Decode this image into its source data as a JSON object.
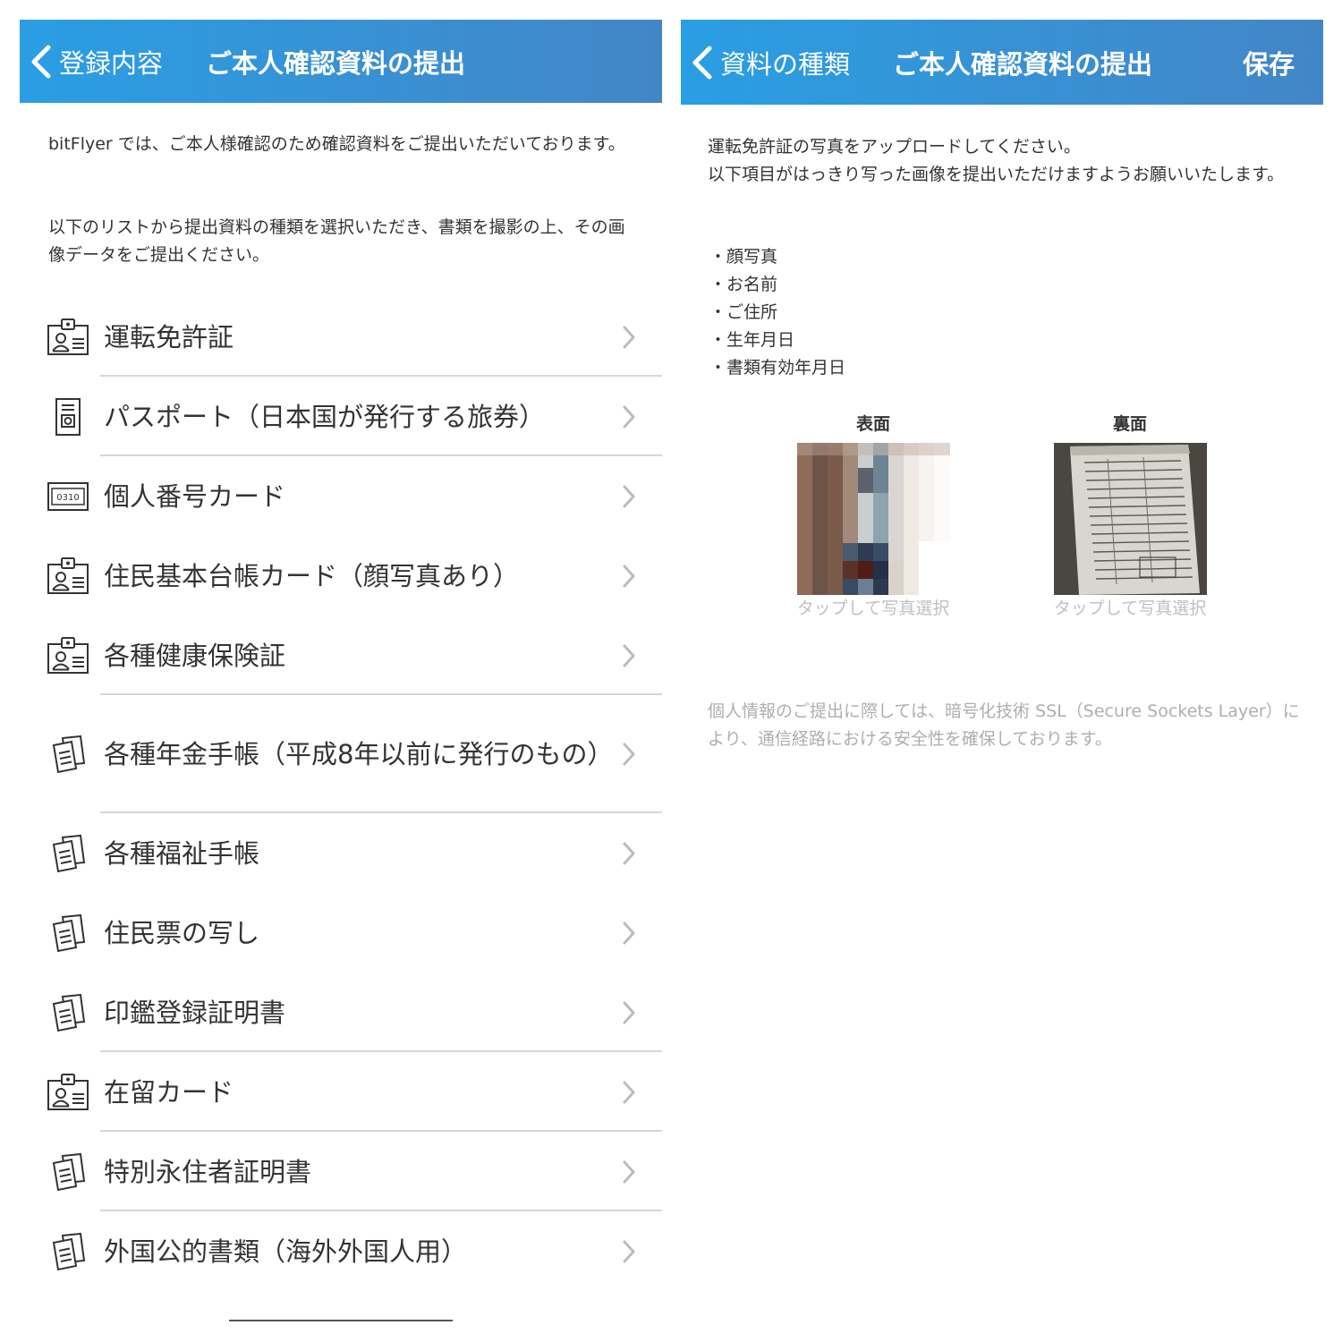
{
  "left_screen": {
    "nav": {
      "back_label": "登録内容",
      "title": "ご本人確認資料の提出"
    },
    "intro": [
      "bitFlyer では、ご本人様確認のため確認資料をご提出いただいております。",
      "以下のリストから提出資料の種類を選択いただき、書類を撮影の上、その画像データをご提出ください。"
    ],
    "documents": [
      {
        "label": "運転免許証",
        "icon": "id-card-icon"
      },
      {
        "label": "パスポート（日本国が発行する旅券）",
        "icon": "passport-icon"
      },
      {
        "label": "個人番号カード",
        "icon": "number-card-icon",
        "icon_text": "0310"
      },
      {
        "label": "住民基本台帳カード（顔写真あり）",
        "icon": "id-card-icon"
      },
      {
        "label": "各種健康保険証",
        "icon": "id-card-icon"
      },
      {
        "label": "各種年金手帳（平成8年以前に発行のもの）",
        "icon": "booklet-icon"
      },
      {
        "label": "各種福祉手帳",
        "icon": "booklet-icon"
      },
      {
        "label": "住民票の写し",
        "icon": "booklet-icon"
      },
      {
        "label": "印鑑登録証明書",
        "icon": "booklet-icon"
      },
      {
        "label": "在留カード",
        "icon": "id-card-icon"
      },
      {
        "label": "特別永住者証明書",
        "icon": "booklet-icon"
      },
      {
        "label": "外国公的書類（海外外国人用）",
        "icon": "booklet-icon"
      }
    ]
  },
  "right_screen": {
    "nav": {
      "back_label": "資料の種類",
      "title": "ご本人確認資料の提出",
      "save_label": "保存"
    },
    "upload_text_1": "運転免許証の写真をアップロードしてください。",
    "upload_text_2": "以下項目がはっきり写った画像を提出いただけますようお願いいたします。",
    "checklist": [
      "・顔写真",
      "・お名前",
      "・ご住所",
      "・生年月日",
      "・書類有効年月日"
    ],
    "front": {
      "title": "表面",
      "caption": "タップして写真選択"
    },
    "back": {
      "title": "裏面",
      "caption": "タップして写真選択"
    },
    "ssl_note": "個人情報のご提出に際しては、暗号化技術 SSL（Secure Sockets Layer）により、通信経路における安全性を確保しております。"
  },
  "colors": {
    "nav_gradient_start": "#2a9ee4",
    "nav_gradient_end": "#4386c6",
    "text": "#333333",
    "muted_text": "#aeaeae",
    "separator": "#d6d6d6"
  }
}
